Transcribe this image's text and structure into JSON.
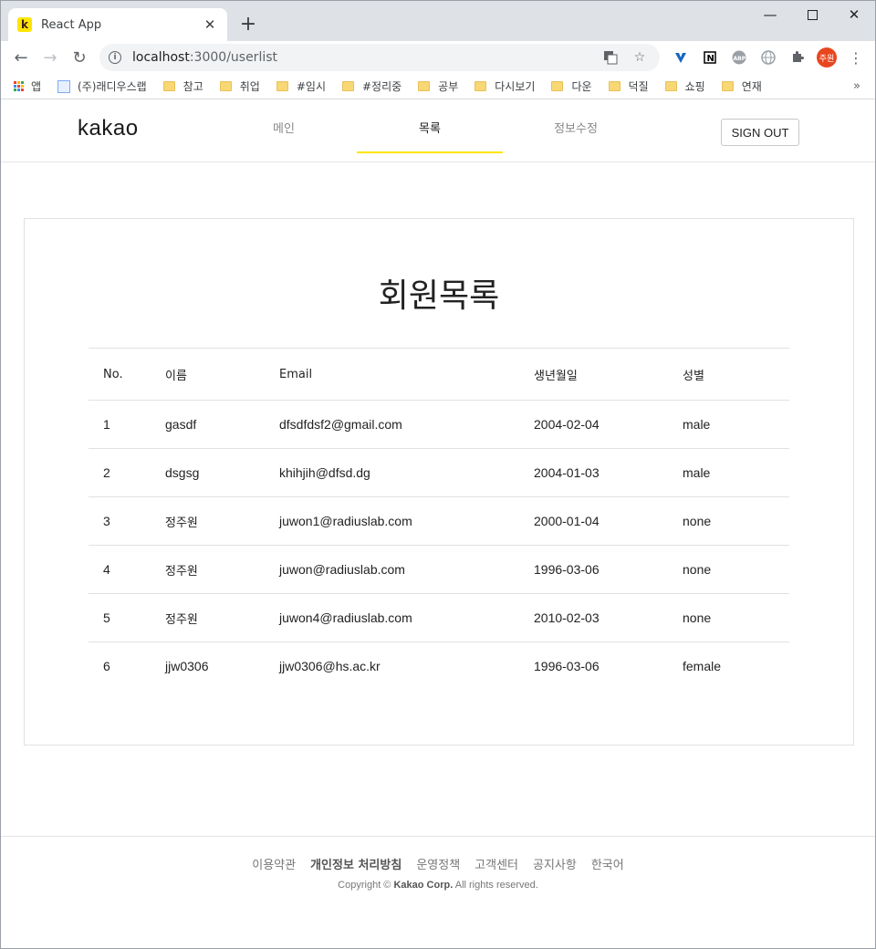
{
  "browser": {
    "tab_title": "React App",
    "tab_favicon": "k",
    "url_host": "localhost",
    "url_rest": ":3000/userlist",
    "profile_label": "주원",
    "bookmarks": [
      "앱",
      "(주)래디우스랩",
      "참고",
      "취업",
      "#임시",
      "#정리중",
      "공부",
      "다시보기",
      "다운",
      "덕질",
      "쇼핑",
      "연재"
    ],
    "more_label": "»"
  },
  "header": {
    "logo": "kakao",
    "nav": [
      {
        "label": "메인"
      },
      {
        "label": "목록"
      },
      {
        "label": "정보수정"
      }
    ],
    "signout_label": "SIGN OUT"
  },
  "main": {
    "title": "회원목록",
    "columns": [
      "No.",
      "이름",
      "Email",
      "생년월일",
      "성별"
    ],
    "rows": [
      {
        "no": "1",
        "name": "gasdf",
        "email": "dfsdfdsf2@gmail.com",
        "birth": "2004-02-04",
        "gender": "male"
      },
      {
        "no": "2",
        "name": "dsgsg",
        "email": "khihjih@dfsd.dg",
        "birth": "2004-01-03",
        "gender": "male"
      },
      {
        "no": "3",
        "name": "정주원",
        "email": "juwon1@radiuslab.com",
        "birth": "2000-01-04",
        "gender": "none"
      },
      {
        "no": "4",
        "name": "정주원",
        "email": "juwon@radiuslab.com",
        "birth": "1996-03-06",
        "gender": "none"
      },
      {
        "no": "5",
        "name": "정주원",
        "email": "juwon4@radiuslab.com",
        "birth": "2010-02-03",
        "gender": "none"
      },
      {
        "no": "6",
        "name": "jjw0306",
        "email": "jjw0306@hs.ac.kr",
        "birth": "1996-03-06",
        "gender": "female"
      }
    ]
  },
  "footer": {
    "links": [
      "이용약관",
      "개인정보 처리방침",
      "운영정책",
      "고객센터",
      "공지사항",
      "한국어"
    ],
    "copyright_prefix": "Copyright ©",
    "copyright_company": "Kakao Corp.",
    "copyright_suffix": "All rights reserved."
  },
  "colors": {
    "accent": "#fee500",
    "profile": "#e8461e"
  }
}
